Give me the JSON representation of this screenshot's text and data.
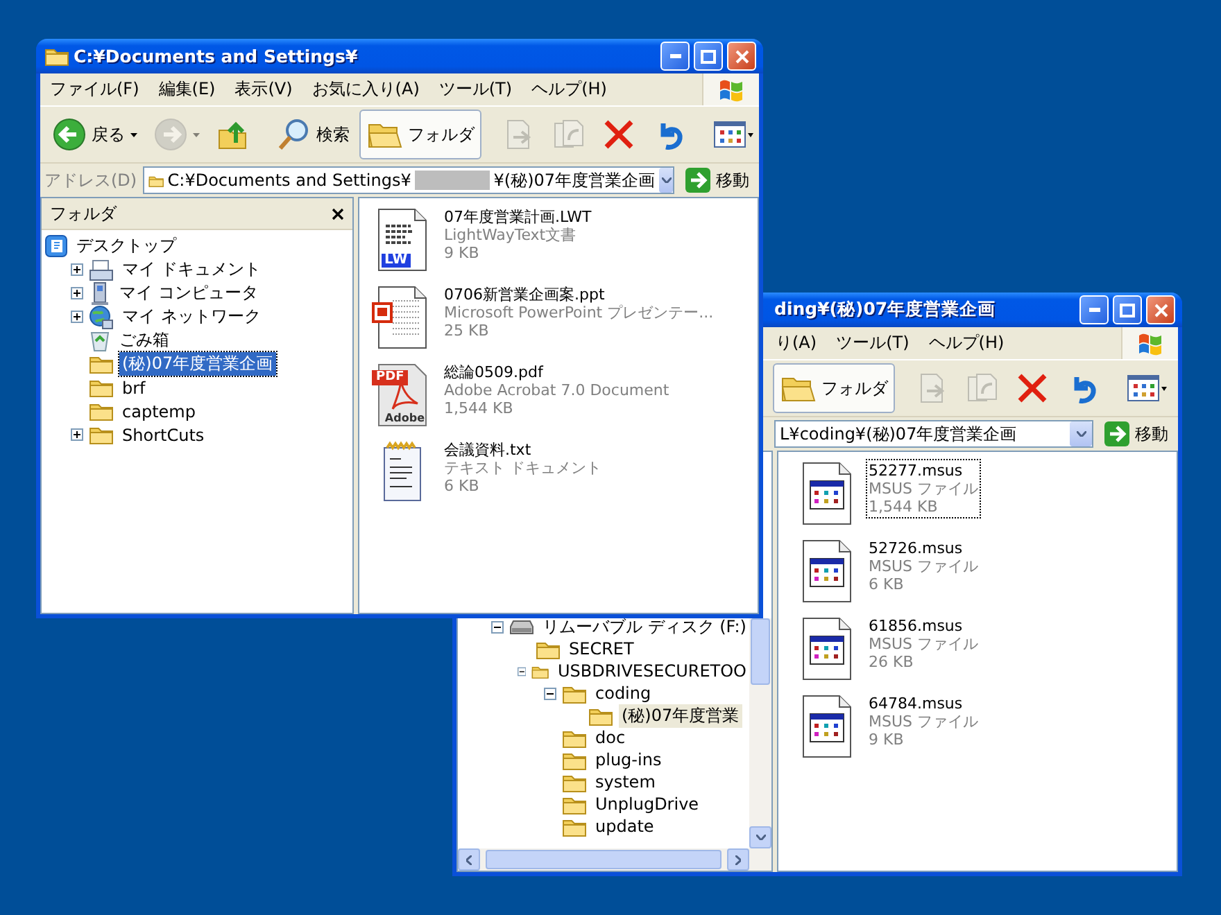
{
  "back_window": {
    "title": "ding¥(秘)07年度営業企画",
    "menu": [
      "り(A)",
      "ツール(T)",
      "ヘルプ(H)"
    ],
    "toolbar": [
      {
        "kind": "folders",
        "label": "フォルダ",
        "selected": true,
        "disabled": false
      },
      {
        "kind": "move_to",
        "selected": false,
        "disabled": true
      },
      {
        "kind": "copy_to",
        "selected": false,
        "disabled": true
      },
      {
        "kind": "delete",
        "selected": false,
        "disabled": false
      },
      {
        "kind": "undo",
        "selected": false,
        "disabled": false
      },
      {
        "kind": "views",
        "selected": false,
        "disabled": false
      }
    ],
    "address": {
      "segments": [
        {
          "kind": "text",
          "text": "L¥coding¥(秘)07年度営業企画"
        }
      ],
      "go_label": "移動"
    },
    "tree": [
      {
        "label": "リムーバブル ディスク (F:)",
        "kind": "drive",
        "expanded": true,
        "selected": false,
        "children": [
          {
            "label": "SECRET",
            "kind": "folder",
            "selected": false
          },
          {
            "label": "USBDRIVESECURETOO",
            "kind": "folder",
            "expanded": true,
            "selected": false,
            "children": [
              {
                "label": "coding",
                "kind": "folder",
                "expanded": true,
                "selected": false,
                "children": [
                  {
                    "label": "(秘)07年度営業",
                    "kind": "folder",
                    "selected": true
                  }
                ]
              },
              {
                "label": "doc",
                "kind": "folder",
                "selected": false
              },
              {
                "label": "plug-ins",
                "kind": "folder",
                "selected": false
              },
              {
                "label": "system",
                "kind": "folder",
                "selected": false
              },
              {
                "label": "UnplugDrive",
                "kind": "folder",
                "selected": false
              },
              {
                "label": "update",
                "kind": "folder",
                "selected": false
              }
            ]
          }
        ]
      }
    ],
    "files": [
      {
        "name": "52277.msus",
        "type": "MSUS ファイル",
        "size": "1,544 KB",
        "kind": "msus",
        "selected": true
      },
      {
        "name": "52726.msus",
        "type": "MSUS ファイル",
        "size": "6 KB",
        "kind": "msus",
        "selected": false
      },
      {
        "name": "61856.msus",
        "type": "MSUS ファイル",
        "size": "26 KB",
        "kind": "msus",
        "selected": false
      },
      {
        "name": "64784.msus",
        "type": "MSUS ファイル",
        "size": "9 KB",
        "kind": "msus",
        "selected": false
      }
    ]
  },
  "front_window": {
    "title": "C:¥Documents and Settings¥",
    "menu": [
      "ファイル(F)",
      "編集(E)",
      "表示(V)",
      "お気に入り(A)",
      "ツール(T)",
      "ヘルプ(H)"
    ],
    "toolbar": [
      {
        "kind": "back",
        "label": "戻る",
        "selected": false,
        "disabled": false
      },
      {
        "kind": "forward",
        "selected": false,
        "disabled": true
      },
      {
        "kind": "up",
        "selected": false,
        "disabled": false
      },
      {
        "kind": "search",
        "label": "検索",
        "selected": false,
        "disabled": false
      },
      {
        "kind": "folders",
        "label": "フォルダ",
        "selected": true,
        "disabled": false
      },
      {
        "kind": "move_to",
        "selected": false,
        "disabled": true
      },
      {
        "kind": "copy_to",
        "selected": false,
        "disabled": true
      },
      {
        "kind": "delete",
        "selected": false,
        "disabled": false
      },
      {
        "kind": "undo",
        "selected": false,
        "disabled": false
      },
      {
        "kind": "views",
        "selected": false,
        "disabled": false
      }
    ],
    "address": {
      "label": "アドレス(D)",
      "segments": [
        {
          "kind": "text",
          "text": "C:¥Documents and Settings¥"
        },
        {
          "kind": "redacted"
        },
        {
          "kind": "text",
          "text": "¥(秘)07年度営業企画"
        }
      ],
      "go_label": "移動"
    },
    "pane_title": "フォルダ",
    "tree": [
      {
        "label": "デスクトップ",
        "kind": "desktop",
        "selected": false,
        "children": [
          {
            "label": "マイ ドキュメント",
            "kind": "documents",
            "expanded": false,
            "selected": false
          },
          {
            "label": "マイ コンピュータ",
            "kind": "computer",
            "expanded": false,
            "selected": false
          },
          {
            "label": "マイ ネットワーク",
            "kind": "network",
            "expanded": false,
            "selected": false
          },
          {
            "label": "ごみ箱",
            "kind": "recycle",
            "selected": false
          },
          {
            "label": "(秘)07年度営業企画",
            "kind": "folder",
            "selected": true
          },
          {
            "label": "brf",
            "kind": "folder",
            "selected": false
          },
          {
            "label": "captemp",
            "kind": "folder",
            "selected": false
          },
          {
            "label": "ShortCuts",
            "kind": "folder",
            "expanded": false,
            "selected": false
          }
        ]
      }
    ],
    "files": [
      {
        "name": "07年度営業計画.LWT",
        "type": "LightWayText文書",
        "size": "9 KB",
        "kind": "lwt",
        "icon_labels": [
          "LW"
        ],
        "selected": false
      },
      {
        "name": "0706新営業企画案.ppt",
        "type": "Microsoft PowerPoint プレゼンテー...",
        "size": "25 KB",
        "kind": "ppt",
        "selected": false
      },
      {
        "name": "総論0509.pdf",
        "type": "Adobe Acrobat 7.0 Document",
        "size": "1,544 KB",
        "kind": "pdf",
        "icon_labels": [
          "PDF",
          "Adobe"
        ],
        "selected": false
      },
      {
        "name": "会議資料.txt",
        "type": "テキスト ドキュメント",
        "size": "6 KB",
        "kind": "txt",
        "selected": false
      }
    ]
  }
}
